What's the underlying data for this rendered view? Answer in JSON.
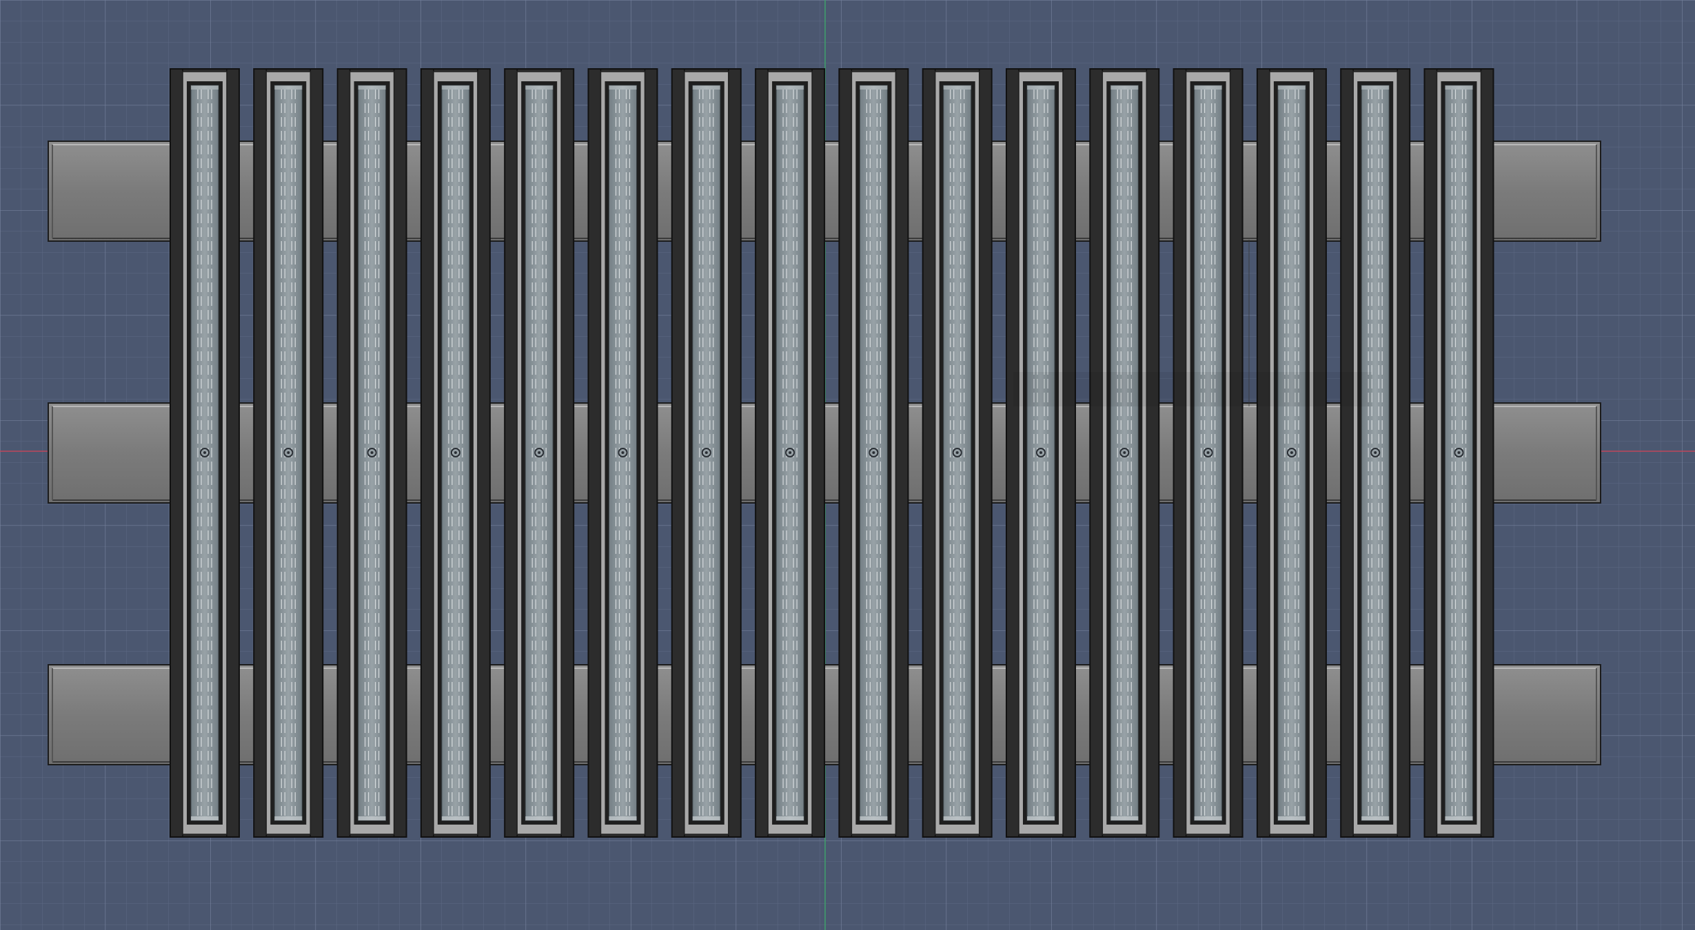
{
  "viewport": {
    "background": "#4b5770",
    "grid_minor_color": "#5d6984",
    "grid_major_color": "#74809b",
    "axis_x_color": "#c0475a",
    "axis_y_color": "#3fa06a"
  },
  "model": {
    "panel_count": 16,
    "crossbar_count": 3,
    "crossbar_color": "#7e7e7e",
    "crossbar_end_color": "#8a8a8a",
    "panel_frame_color": "#2c2c2c",
    "panel_glass_color": "#8a9499",
    "panel_rim_color": "#a9a9a9",
    "dashed_line_color": "#e4e8ea",
    "center_marker_color": "#2a2f35",
    "icons": {
      "origin_marker": "crosshair-dot-icon"
    }
  }
}
